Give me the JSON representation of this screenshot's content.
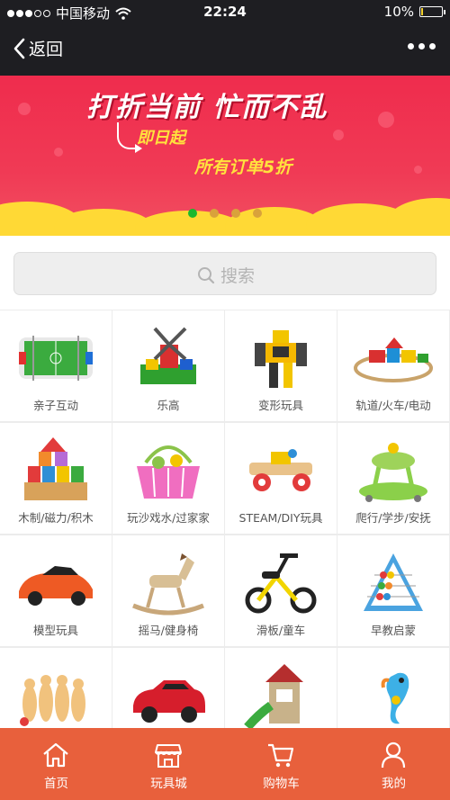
{
  "status_bar": {
    "carrier": "中国移动",
    "time": "22:24",
    "battery": "10%",
    "battery_level": 0.1
  },
  "nav": {
    "back_label": "返回"
  },
  "banner": {
    "headline": "打折当前 忙而不乱",
    "subline": "即日起",
    "offer": "所有订单5折",
    "slide_count": 4,
    "active_slide": 0,
    "colors": {
      "background": "#ef2c4d",
      "accent_text": "#ffe23d",
      "wave": "#ffd935",
      "active_dot": "#1bb82e"
    }
  },
  "search": {
    "placeholder": "搜索"
  },
  "categories": [
    {
      "label": "亲子互动",
      "icon": "foosball-table"
    },
    {
      "label": "乐高",
      "icon": "lego-windmill"
    },
    {
      "label": "变形玩具",
      "icon": "transformer-robot"
    },
    {
      "label": "轨道/火车/电动",
      "icon": "train-track"
    },
    {
      "label": "木制/磁力/积木",
      "icon": "wooden-blocks"
    },
    {
      "label": "玩沙戏水/过家家",
      "icon": "pink-basket"
    },
    {
      "label": "STEAM/DIY玩具",
      "icon": "diy-car"
    },
    {
      "label": "爬行/学步/安抚",
      "icon": "baby-walker"
    },
    {
      "label": "模型玩具",
      "icon": "model-car"
    },
    {
      "label": "摇马/健身椅",
      "icon": "rocking-horse"
    },
    {
      "label": "滑板/童车",
      "icon": "tricycle"
    },
    {
      "label": "早教启蒙",
      "icon": "abacus"
    },
    {
      "label": "",
      "icon": "bowling-pins"
    },
    {
      "label": "",
      "icon": "ride-on-car"
    },
    {
      "label": "",
      "icon": "playhouse-slide"
    },
    {
      "label": "",
      "icon": "seahorse-toy"
    }
  ],
  "tabs": [
    {
      "label": "首页",
      "icon": "home-icon"
    },
    {
      "label": "玩具城",
      "icon": "store-icon"
    },
    {
      "label": "购物车",
      "icon": "cart-icon"
    },
    {
      "label": "我的",
      "icon": "user-icon"
    }
  ],
  "tab_bar_color": "#e8603c"
}
